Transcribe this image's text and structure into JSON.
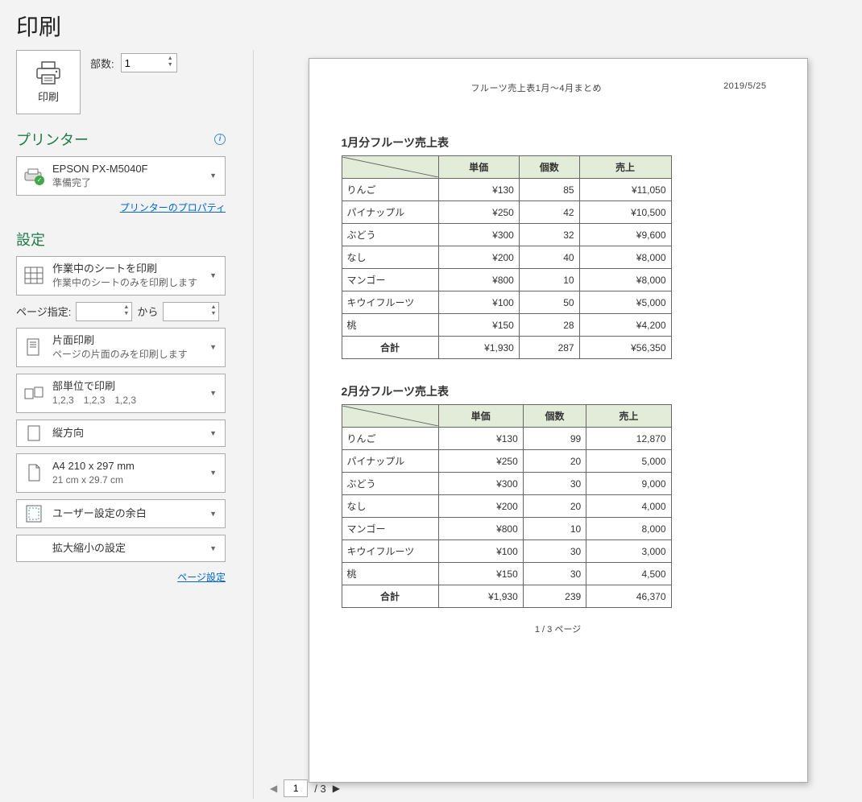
{
  "title": "印刷",
  "copies": {
    "label": "部数:",
    "value": "1"
  },
  "print_button_label": "印刷",
  "printer_section": "プリンター",
  "printer": {
    "name": "EPSON PX-M5040F",
    "status": "準備完了"
  },
  "printer_properties_link": "プリンターのプロパティ",
  "settings_section": "設定",
  "print_what": {
    "primary": "作業中のシートを印刷",
    "secondary": "作業中のシートのみを印刷します"
  },
  "page_range": {
    "label": "ページ指定:",
    "to": "から"
  },
  "duplex": {
    "primary": "片面印刷",
    "secondary": "ページの片面のみを印刷します"
  },
  "collation": {
    "primary": "部単位で印刷",
    "secondary": "1,2,3　1,2,3　1,2,3"
  },
  "orientation": {
    "primary": "縦方向"
  },
  "paper": {
    "primary": "A4 210 x 297 mm",
    "secondary": "21 cm x 29.7 cm"
  },
  "margins": {
    "primary": "ユーザー設定の余白"
  },
  "scaling": {
    "primary": "拡大縮小の設定"
  },
  "page_setup_link": "ページ設定",
  "preview": {
    "header_center": "フルーツ売上表1月～4月まとめ",
    "header_right": "2019/5/25",
    "footer": "1 / 3 ページ",
    "tables": [
      {
        "title": "1月分フルーツ売上表",
        "headers": [
          "単価",
          "個数",
          "売上"
        ],
        "rows": [
          {
            "name": "りんご",
            "c": [
              "¥130",
              "85",
              "¥11,050"
            ]
          },
          {
            "name": "パイナップル",
            "c": [
              "¥250",
              "42",
              "¥10,500"
            ]
          },
          {
            "name": "ぶどう",
            "c": [
              "¥300",
              "32",
              "¥9,600"
            ]
          },
          {
            "name": "なし",
            "c": [
              "¥200",
              "40",
              "¥8,000"
            ]
          },
          {
            "name": "マンゴー",
            "c": [
              "¥800",
              "10",
              "¥8,000"
            ]
          },
          {
            "name": "キウイフルーツ",
            "c": [
              "¥100",
              "50",
              "¥5,000"
            ]
          },
          {
            "name": "桃",
            "c": [
              "¥150",
              "28",
              "¥4,200"
            ]
          }
        ],
        "total": {
          "name": "合計",
          "c": [
            "¥1,930",
            "287",
            "¥56,350"
          ]
        }
      },
      {
        "title": "2月分フルーツ売上表",
        "headers": [
          "単価",
          "個数",
          "売上"
        ],
        "rows": [
          {
            "name": "りんご",
            "c": [
              "¥130",
              "99",
              "12,870"
            ]
          },
          {
            "name": "パイナップル",
            "c": [
              "¥250",
              "20",
              "5,000"
            ]
          },
          {
            "name": "ぶどう",
            "c": [
              "¥300",
              "30",
              "9,000"
            ]
          },
          {
            "name": "なし",
            "c": [
              "¥200",
              "20",
              "4,000"
            ]
          },
          {
            "name": "マンゴー",
            "c": [
              "¥800",
              "10",
              "8,000"
            ]
          },
          {
            "name": "キウイフルーツ",
            "c": [
              "¥100",
              "30",
              "3,000"
            ]
          },
          {
            "name": "桃",
            "c": [
              "¥150",
              "30",
              "4,500"
            ]
          }
        ],
        "total": {
          "name": "合計",
          "c": [
            "¥1,930",
            "239",
            "46,370"
          ]
        }
      }
    ]
  },
  "page_nav": {
    "current": "1",
    "total": "/ 3"
  }
}
